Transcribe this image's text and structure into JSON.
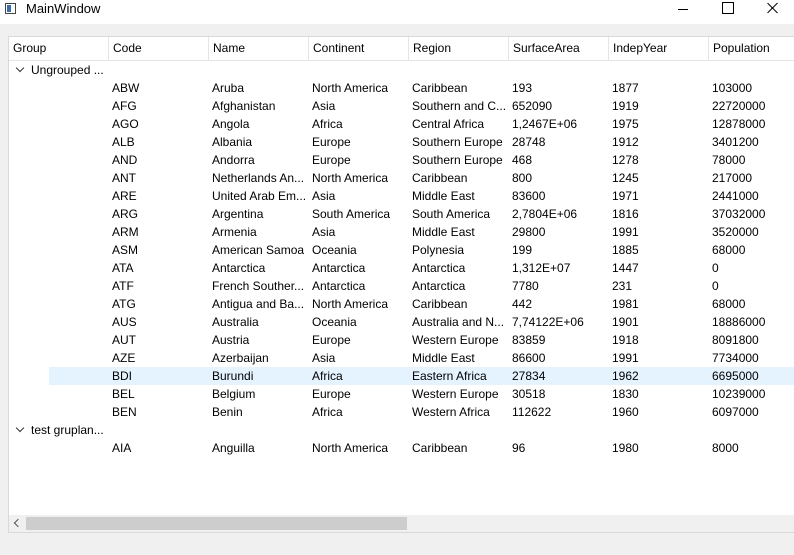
{
  "window": {
    "title": "MainWindow"
  },
  "columns": [
    "Group",
    "Code",
    "Name",
    "Continent",
    "Region",
    "SurfaceArea",
    "IndepYear",
    "Population"
  ],
  "groups": [
    {
      "label": "Ungrouped ...",
      "rows": [
        [
          "ABW",
          "Aruba",
          "North America",
          "Caribbean",
          "193",
          "1877",
          "103000"
        ],
        [
          "AFG",
          "Afghanistan",
          "Asia",
          "Southern and C...",
          "652090",
          "1919",
          "22720000"
        ],
        [
          "AGO",
          "Angola",
          "Africa",
          "Central Africa",
          "1,2467E+06",
          "1975",
          "12878000"
        ],
        [
          "ALB",
          "Albania",
          "Europe",
          "Southern Europe",
          "28748",
          "1912",
          "3401200"
        ],
        [
          "AND",
          "Andorra",
          "Europe",
          "Southern Europe",
          "468",
          "1278",
          "78000"
        ],
        [
          "ANT",
          "Netherlands An...",
          "North America",
          "Caribbean",
          "800",
          "1245",
          "217000"
        ],
        [
          "ARE",
          "United Arab Em...",
          "Asia",
          "Middle East",
          "83600",
          "1971",
          "2441000"
        ],
        [
          "ARG",
          "Argentina",
          "South America",
          "South America",
          "2,7804E+06",
          "1816",
          "37032000"
        ],
        [
          "ARM",
          "Armenia",
          "Asia",
          "Middle East",
          "29800",
          "1991",
          "3520000"
        ],
        [
          "ASM",
          "American Samoa",
          "Oceania",
          "Polynesia",
          "199",
          "1885",
          "68000"
        ],
        [
          "ATA",
          "Antarctica",
          "Antarctica",
          "Antarctica",
          "1,312E+07",
          "1447",
          "0"
        ],
        [
          "ATF",
          "French Souther...",
          "Antarctica",
          "Antarctica",
          "7780",
          "231",
          "0"
        ],
        [
          "ATG",
          "Antigua and Ba...",
          "North America",
          "Caribbean",
          "442",
          "1981",
          "68000"
        ],
        [
          "AUS",
          "Australia",
          "Oceania",
          "Australia and N...",
          "7,74122E+06",
          "1901",
          "18886000"
        ],
        [
          "AUT",
          "Austria",
          "Europe",
          "Western Europe",
          "83859",
          "1918",
          "8091800"
        ],
        [
          "AZE",
          "Azerbaijan",
          "Asia",
          "Middle East",
          "86600",
          "1991",
          "7734000"
        ],
        [
          "BDI",
          "Burundi",
          "Africa",
          "Eastern Africa",
          "27834",
          "1962",
          "6695000"
        ],
        [
          "BEL",
          "Belgium",
          "Europe",
          "Western Europe",
          "30518",
          "1830",
          "10239000"
        ],
        [
          "BEN",
          "Benin",
          "Africa",
          "Western Africa",
          "112622",
          "1960",
          "6097000"
        ]
      ]
    },
    {
      "label": "test gruplan...",
      "rows": [
        [
          "AIA",
          "Anguilla",
          "North America",
          "Caribbean",
          "96",
          "1980",
          "8000"
        ]
      ]
    }
  ],
  "selected_code": "BDI",
  "colors": {
    "selection": "#e5f3ff",
    "border": "#d9d9d9",
    "scroll_thumb": "#cdcdcd"
  }
}
